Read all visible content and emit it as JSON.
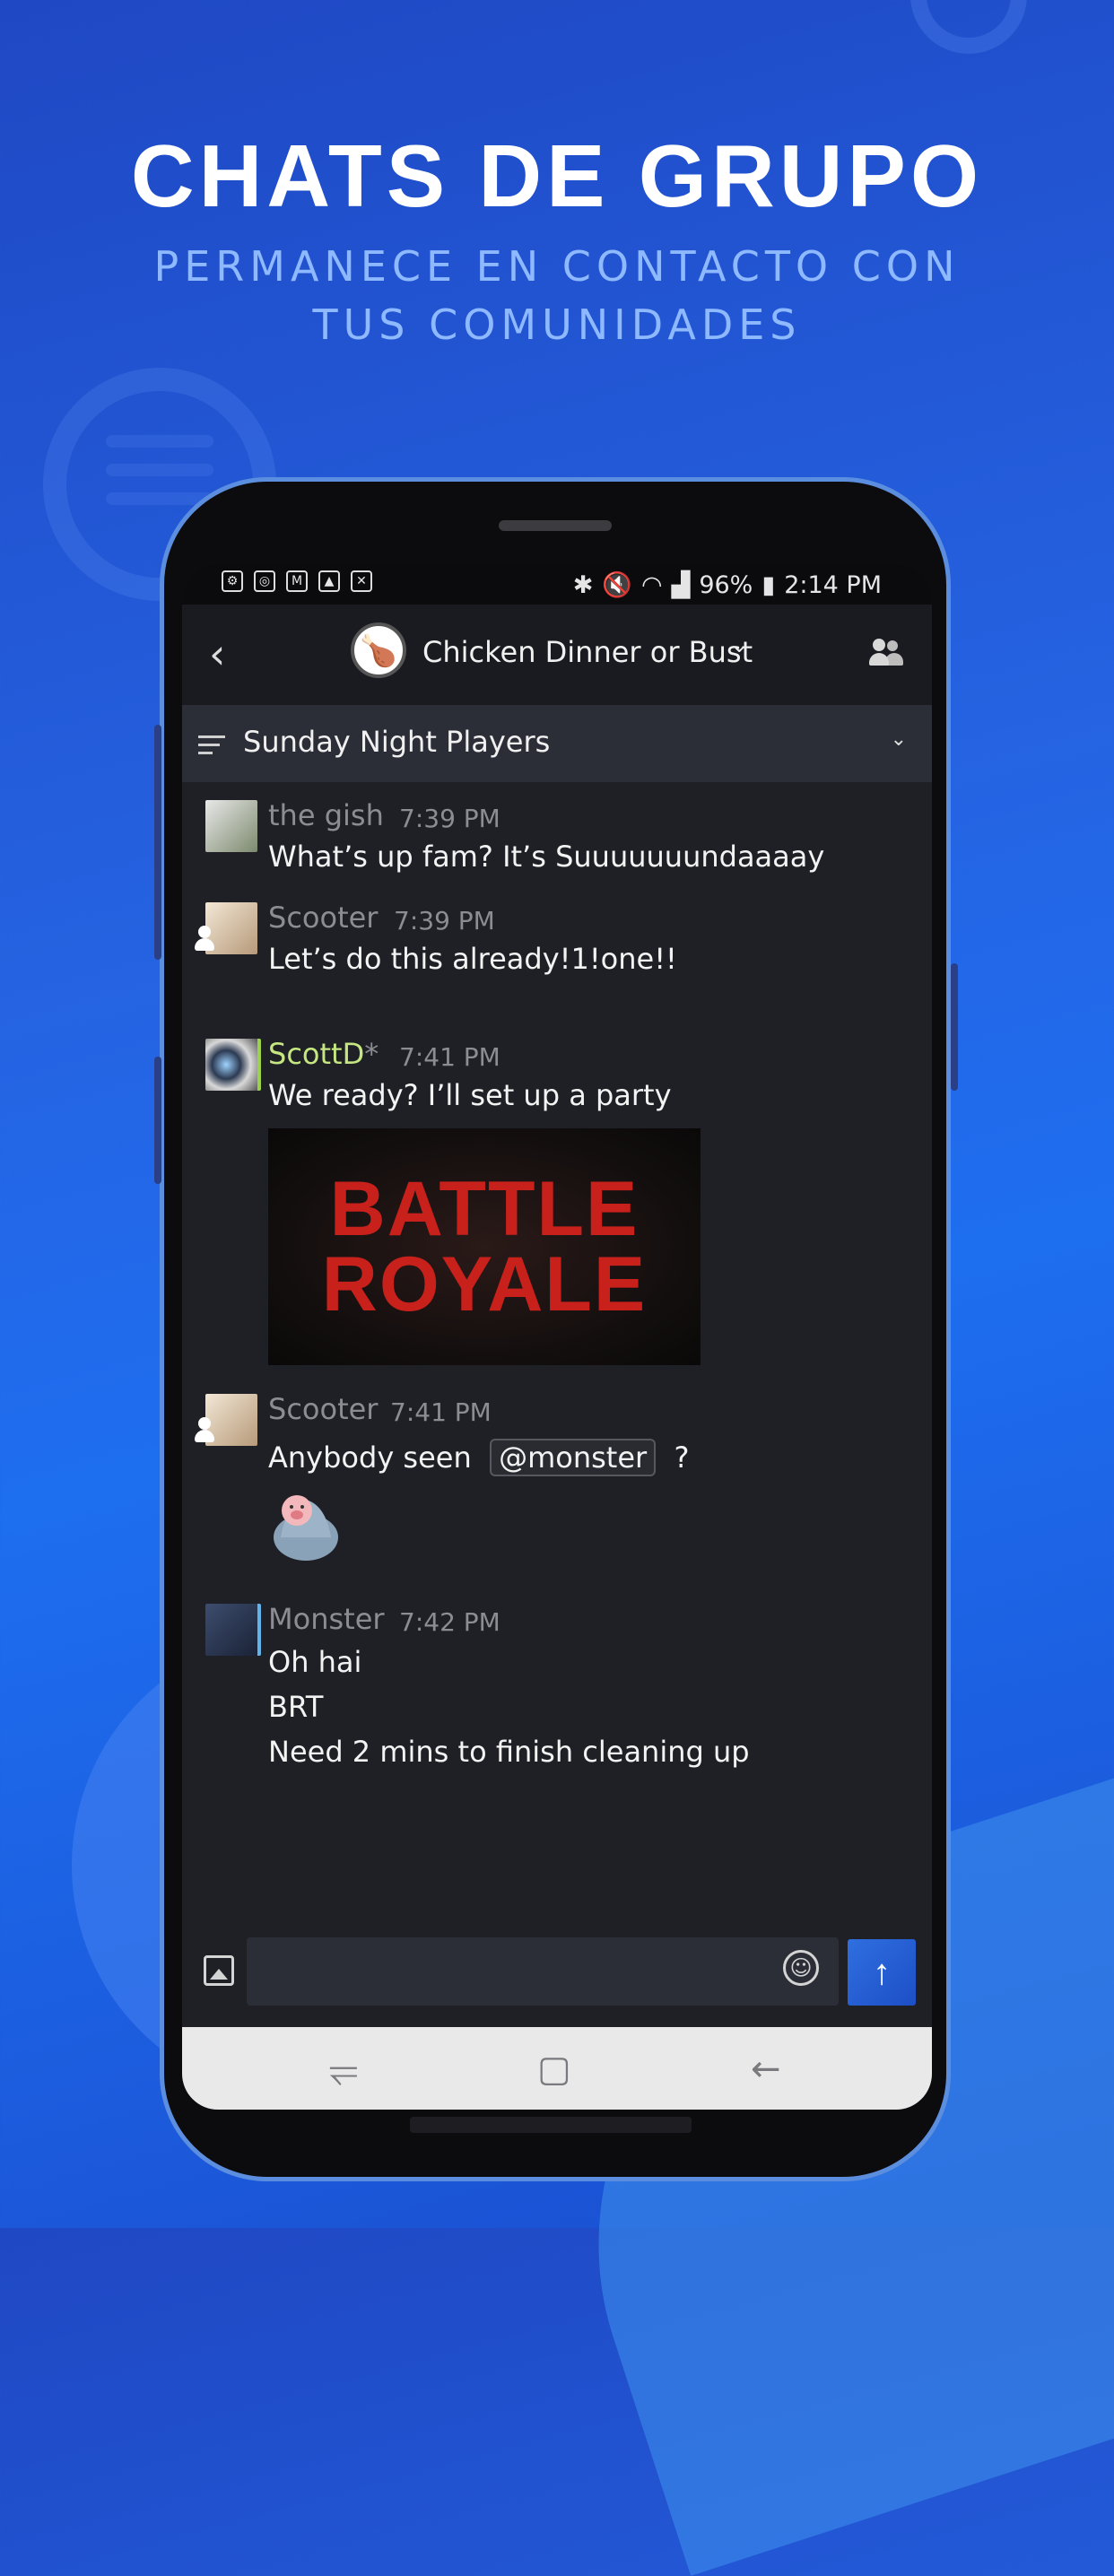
{
  "headline": {
    "title": "CHATS DE GRUPO",
    "subtitle_line1": "PERMANECE EN CONTACTO CON",
    "subtitle_line2": "TUS COMUNIDADES"
  },
  "status_bar": {
    "battery": "96%",
    "time": "2:14 PM",
    "left_icons": [
      "settings-icon",
      "search-doc-icon",
      "mail-icon",
      "image-icon",
      "calendar-icon"
    ],
    "right_icons": [
      "bluetooth-icon",
      "mute-icon",
      "wifi-icon",
      "signal-icon",
      "battery-icon"
    ]
  },
  "header": {
    "group_name": "Chicken Dinner or Bust",
    "group_icon": "roast-chicken-icon"
  },
  "channel": {
    "name": "Sunday Night Players"
  },
  "messages": [
    {
      "user": "the gish",
      "time": "7:39 PM",
      "lines": [
        "What’s up fam? It’s Suuuuuuundaaaay"
      ],
      "user_color": "#8c8d92"
    },
    {
      "user": "Scooter",
      "time": "7:39 PM",
      "lines": [
        "Let’s do this already!1!one!!"
      ],
      "user_color": "#8c8d92"
    },
    {
      "user": "ScottD",
      "user_suffix": "*",
      "time": "7:41 PM",
      "lines": [
        "We ready? I’ll set up a party"
      ],
      "user_color": "#c5e680",
      "image_text": [
        "BATTLE",
        "ROYALE"
      ]
    },
    {
      "user": "Scooter",
      "time": "7:41 PM",
      "text_before": "Anybody seen",
      "mention": "@monster",
      "text_after": "?",
      "user_color": "#8c8d92"
    },
    {
      "user": "Monster",
      "time": "7:42 PM",
      "lines": [
        "Oh hai",
        "BRT",
        "Need 2 mins to finish cleaning up"
      ],
      "user_color": "#8c8d92"
    }
  ],
  "composer": {
    "placeholder": "",
    "send_icon": "arrow-up-icon"
  },
  "colors": {
    "background": "#2563e2",
    "screen_bg": "#1f2026",
    "appbar_bg": "#1a1b20",
    "channel_bg": "#2c2e37",
    "accent": "#2f6fe0",
    "battle_red": "#c8211c"
  }
}
